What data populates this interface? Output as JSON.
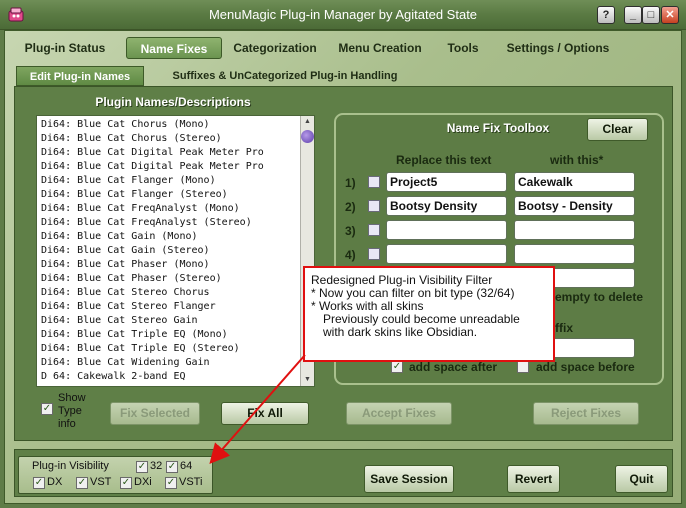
{
  "window": {
    "title": "MenuMagic Plug-in Manager by Agitated State",
    "controls": [
      "?",
      "_",
      "□",
      "✕"
    ]
  },
  "tabs": [
    {
      "label": "Plug-in Status",
      "active": false
    },
    {
      "label": "Name Fixes",
      "active": true
    },
    {
      "label": "Categorization",
      "active": false
    },
    {
      "label": "Menu Creation",
      "active": false
    },
    {
      "label": "Tools",
      "active": false
    },
    {
      "label": "Settings / Options",
      "active": false
    }
  ],
  "subtabs": [
    {
      "label": "Edit Plug-in Names",
      "active": true
    },
    {
      "label": "Suffixes  & UnCategorized Plug-in Handling",
      "active": false
    }
  ],
  "names_panel": {
    "heading": "Plugin Names/Descriptions",
    "items": [
      "Di64: Blue Cat Chorus (Mono)",
      "Di64: Blue Cat Chorus (Stereo)",
      "Di64: Blue Cat Digital Peak Meter Pro",
      "Di64: Blue Cat Digital Peak Meter Pro",
      "Di64: Blue Cat Flanger (Mono)",
      "Di64: Blue Cat Flanger (Stereo)",
      "Di64: Blue Cat FreqAnalyst (Mono)",
      "Di64: Blue Cat FreqAnalyst (Stereo)",
      "Di64: Blue Cat Gain (Mono)",
      "Di64: Blue Cat Gain (Stereo)",
      "Di64: Blue Cat Phaser (Mono)",
      "Di64: Blue Cat Phaser (Stereo)",
      "Di64: Blue Cat Stereo Chorus",
      "Di64: Blue Cat Stereo Flanger",
      "Di64: Blue Cat Stereo Gain",
      "Di64: Blue Cat Triple EQ (Mono)",
      "Di64: Blue Cat Triple EQ (Stereo)",
      "Di64: Blue Cat Widening Gain",
      "D 64: Cakewalk 2-band EQ"
    ],
    "show_type_info_label": "Show Type info",
    "show_type_info_checked": true
  },
  "toolbox": {
    "title": "Name Fix Toolbox",
    "clear_label": "Clear",
    "col_replace": "Replace this text",
    "col_with": "with this*",
    "rows": [
      {
        "num": "1)",
        "replace": "Project5",
        "with": "Cakewalk"
      },
      {
        "num": "2)",
        "replace": "Bootsy Density",
        "with": "Bootsy - Density"
      },
      {
        "num": "3)",
        "replace": "",
        "with": ""
      },
      {
        "num": "4)",
        "replace": "",
        "with": ""
      }
    ],
    "empty_delete_note": "empty to delete",
    "suffix_partial": "ffix",
    "add_space_after": "add space after",
    "add_space_after_checked": true,
    "add_space_before": "add space before",
    "add_space_before_checked": false
  },
  "actions": {
    "fix_selected": "Fix Selected",
    "fix_all": "Fix All",
    "accept_fixes": "Accept Fixes",
    "reject_fixes": "Reject Fixes"
  },
  "visibility": {
    "title": "Plug-in Visibility",
    "bits": [
      {
        "label": "32",
        "checked": true
      },
      {
        "label": "64",
        "checked": true
      }
    ],
    "types": [
      {
        "label": "DX",
        "checked": true
      },
      {
        "label": "VST",
        "checked": true
      },
      {
        "label": "DXi",
        "checked": true
      },
      {
        "label": "VSTi",
        "checked": true
      }
    ]
  },
  "footer": {
    "save_session": "Save Session",
    "revert": "Revert",
    "quit": "Quit"
  },
  "callout": {
    "lines": [
      "Redesigned Plug-in Visibility Filter",
      "* Now you can filter on bit type (32/64)",
      "* Works with all skins",
      "   Previously could become unreadable",
      "   with dark skins like Obsidian."
    ]
  },
  "colors": {
    "title_bar": "#5a7a43",
    "panel_green": "#5f7f47",
    "frame_light": "#b4c79a",
    "callout_border": "#e01010"
  }
}
